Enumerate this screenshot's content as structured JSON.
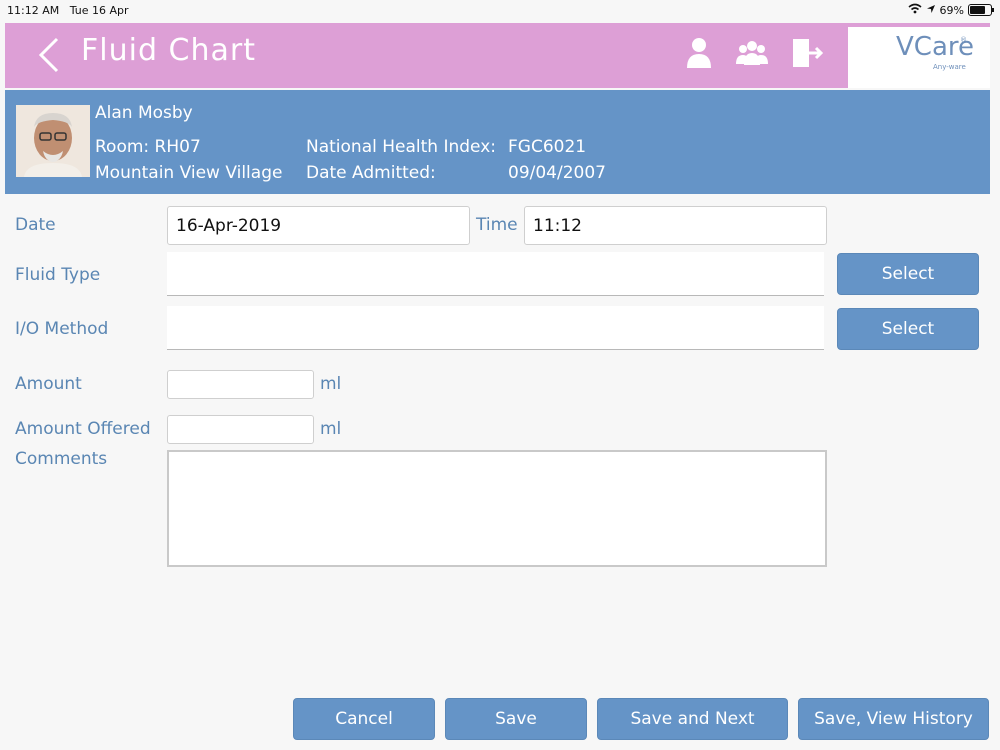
{
  "status_bar": {
    "time": "11:12 AM",
    "date": "Tue 16 Apr",
    "battery": "69%",
    "battery_level": 0.69
  },
  "header": {
    "title": "Fluid Chart",
    "logo": "VCare",
    "logo_sub": "Any-ware",
    "icons": [
      "back-chevron-icon",
      "user-icon",
      "group-icon",
      "logout-icon"
    ],
    "color": "#dd9fd6"
  },
  "patient": {
    "name": "Alan Mosby",
    "room_label": "Room:",
    "room": "RH07",
    "village": "Mountain View Village",
    "nhi_label": "National Health Index:",
    "nhi": "FGC6021",
    "admitted_label": "Date Admitted:",
    "admitted": "09/04/2007",
    "color": "#6594c7"
  },
  "form": {
    "date_label": "Date",
    "date_value": "16-Apr-2019",
    "time_label": "Time",
    "time_value": "11:12",
    "fluid_type_label": "Fluid Type",
    "fluid_type_value": "",
    "io_method_label": "I/O Method",
    "io_method_value": "",
    "select_label": "Select",
    "amount_label": "Amount",
    "amount_value": "",
    "amount_offered_label": "Amount Offered",
    "amount_offered_value": "",
    "unit": "ml",
    "comments_label": "Comments",
    "comments_value": ""
  },
  "footer": {
    "cancel": "Cancel",
    "save": "Save",
    "save_next": "Save and Next",
    "save_history": "Save, View History"
  }
}
